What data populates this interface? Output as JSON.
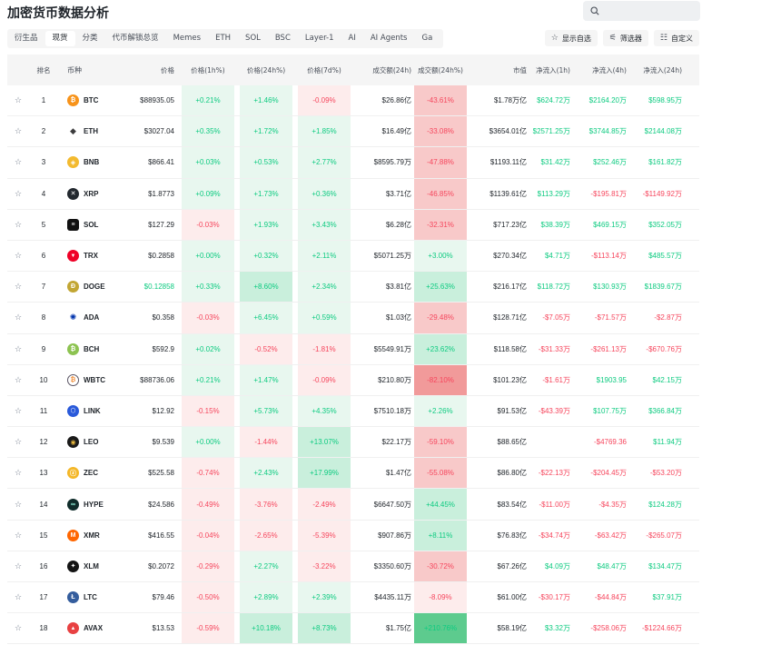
{
  "page": {
    "title": "加密货币数据分析"
  },
  "search": {
    "placeholder": ""
  },
  "tabs": [
    {
      "label": "衍生品",
      "active": false
    },
    {
      "label": "现货",
      "active": true
    },
    {
      "label": "分类",
      "active": false
    },
    {
      "label": "代币解锁总览",
      "active": false
    },
    {
      "label": "Memes",
      "active": false
    },
    {
      "label": "ETH",
      "active": false
    },
    {
      "label": "SOL",
      "active": false
    },
    {
      "label": "BSC",
      "active": false
    },
    {
      "label": "Layer-1",
      "active": false
    },
    {
      "label": "AI",
      "active": false
    },
    {
      "label": "AI Agents",
      "active": false
    },
    {
      "label": "Ga",
      "active": false
    }
  ],
  "actions": {
    "show_favorites": "显示自选",
    "filter": "筛选器",
    "customize": "自定义"
  },
  "columns": {
    "rank": "排名",
    "coin": "币种",
    "price": "价格",
    "p1h": "价格(1h%)",
    "p24h": "价格(24h%)",
    "p7d": "价格(7d%)",
    "vol": "成交额(24h)",
    "volc": "成交额(24h%)",
    "mcap": "市值",
    "n1h": "净流入(1h)",
    "n4h": "净流入(4h)",
    "n24h": "净流入(24h)"
  },
  "colors": {
    "positive": "#0ecb81",
    "negative": "#f6465d"
  },
  "rows": [
    {
      "rank": "1",
      "symbol": "BTC",
      "icon": "bitcoin-icon",
      "price": "$88935.05",
      "p1h": "+0.21%",
      "p24h": "+1.46%",
      "p7d": "-0.09%",
      "vol": "$26.86亿",
      "volc": "-43.61%",
      "mcap": "$1.78万亿",
      "n1h": "$624.72万",
      "n4h": "$2164.20万",
      "n24h": "$598.95万"
    },
    {
      "rank": "2",
      "symbol": "ETH",
      "icon": "ethereum-icon",
      "price": "$3027.04",
      "p1h": "+0.35%",
      "p24h": "+1.72%",
      "p7d": "+1.85%",
      "vol": "$16.49亿",
      "volc": "-33.08%",
      "mcap": "$3654.01亿",
      "n1h": "$2571.25万",
      "n4h": "$3744.85万",
      "n24h": "$2144.08万"
    },
    {
      "rank": "3",
      "symbol": "BNB",
      "icon": "bnb-icon",
      "price": "$866.41",
      "p1h": "+0.03%",
      "p24h": "+0.53%",
      "p7d": "+2.77%",
      "vol": "$8595.79万",
      "volc": "-47.88%",
      "mcap": "$1193.11亿",
      "n1h": "$31.42万",
      "n4h": "$252.46万",
      "n24h": "$161.82万"
    },
    {
      "rank": "4",
      "symbol": "XRP",
      "icon": "xrp-icon",
      "price": "$1.8773",
      "p1h": "+0.09%",
      "p24h": "+1.73%",
      "p7d": "+0.36%",
      "vol": "$3.71亿",
      "volc": "-46.85%",
      "mcap": "$1139.61亿",
      "n1h": "$113.29万",
      "n4h": "-$195.81万",
      "n24h": "-$1149.92万"
    },
    {
      "rank": "5",
      "symbol": "SOL",
      "icon": "solana-icon",
      "price": "$127.29",
      "p1h": "-0.03%",
      "p24h": "+1.93%",
      "p7d": "+3.43%",
      "vol": "$6.28亿",
      "volc": "-32.31%",
      "mcap": "$717.23亿",
      "n1h": "$38.39万",
      "n4h": "$469.15万",
      "n24h": "$352.05万"
    },
    {
      "rank": "6",
      "symbol": "TRX",
      "icon": "tron-icon",
      "price": "$0.2858",
      "p1h": "+0.00%",
      "p24h": "+0.32%",
      "p7d": "+2.11%",
      "vol": "$5071.25万",
      "volc": "+3.00%",
      "mcap": "$270.34亿",
      "n1h": "$4.71万",
      "n4h": "-$113.14万",
      "n24h": "$485.57万"
    },
    {
      "rank": "7",
      "symbol": "DOGE",
      "icon": "dogecoin-icon",
      "price": "$0.12858",
      "p1h": "+0.33%",
      "p24h": "+8.60%",
      "p7d": "+2.34%",
      "vol": "$3.81亿",
      "volc": "+25.63%",
      "mcap": "$216.17亿",
      "n1h": "$118.72万",
      "n4h": "$130.93万",
      "n24h": "$1839.67万"
    },
    {
      "rank": "8",
      "symbol": "ADA",
      "icon": "cardano-icon",
      "price": "$0.358",
      "p1h": "-0.03%",
      "p24h": "+6.45%",
      "p7d": "+0.59%",
      "vol": "$1.03亿",
      "volc": "-29.48%",
      "mcap": "$128.71亿",
      "n1h": "-$7.05万",
      "n4h": "-$71.57万",
      "n24h": "-$2.87万"
    },
    {
      "rank": "9",
      "symbol": "BCH",
      "icon": "bitcoin-cash-icon",
      "price": "$592.9",
      "p1h": "+0.02%",
      "p24h": "-0.52%",
      "p7d": "-1.81%",
      "vol": "$5549.91万",
      "volc": "+23.62%",
      "mcap": "$118.58亿",
      "n1h": "-$31.33万",
      "n4h": "-$261.13万",
      "n24h": "-$670.76万"
    },
    {
      "rank": "10",
      "symbol": "WBTC",
      "icon": "wrapped-bitcoin-icon",
      "price": "$88736.06",
      "p1h": "+0.21%",
      "p24h": "+1.47%",
      "p7d": "-0.09%",
      "vol": "$210.80万",
      "volc": "-82.10%",
      "mcap": "$101.23亿",
      "n1h": "-$1.61万",
      "n4h": "$1903.95",
      "n24h": "$42.15万"
    },
    {
      "rank": "11",
      "symbol": "LINK",
      "icon": "chainlink-icon",
      "price": "$12.92",
      "p1h": "-0.15%",
      "p24h": "+5.73%",
      "p7d": "+4.35%",
      "vol": "$7510.18万",
      "volc": "+2.26%",
      "mcap": "$91.53亿",
      "n1h": "-$43.39万",
      "n4h": "$107.75万",
      "n24h": "$366.84万"
    },
    {
      "rank": "12",
      "symbol": "LEO",
      "icon": "leo-icon",
      "price": "$9.539",
      "p1h": "+0.00%",
      "p24h": "-1.44%",
      "p7d": "+13.07%",
      "vol": "$22.17万",
      "volc": "-59.10%",
      "mcap": "$88.65亿",
      "n1h": "",
      "n4h": "-$4769.36",
      "n24h": "$11.94万"
    },
    {
      "rank": "13",
      "symbol": "ZEC",
      "icon": "zcash-icon",
      "price": "$525.58",
      "p1h": "-0.74%",
      "p24h": "+2.43%",
      "p7d": "+17.99%",
      "vol": "$1.47亿",
      "volc": "-55.08%",
      "mcap": "$86.80亿",
      "n1h": "-$22.13万",
      "n4h": "-$204.45万",
      "n24h": "-$53.20万"
    },
    {
      "rank": "14",
      "symbol": "HYPE",
      "icon": "hyperliquid-icon",
      "price": "$24.586",
      "p1h": "-0.49%",
      "p24h": "-3.76%",
      "p7d": "-2.49%",
      "vol": "$6647.50万",
      "volc": "+44.45%",
      "mcap": "$83.54亿",
      "n1h": "-$11.00万",
      "n4h": "-$4.35万",
      "n24h": "$124.28万"
    },
    {
      "rank": "15",
      "symbol": "XMR",
      "icon": "monero-icon",
      "price": "$416.55",
      "p1h": "-0.04%",
      "p24h": "-2.65%",
      "p7d": "-5.39%",
      "vol": "$907.86万",
      "volc": "+8.11%",
      "mcap": "$76.83亿",
      "n1h": "-$34.74万",
      "n4h": "-$63.42万",
      "n24h": "-$265.07万"
    },
    {
      "rank": "16",
      "symbol": "XLM",
      "icon": "stellar-icon",
      "price": "$0.2072",
      "p1h": "-0.29%",
      "p24h": "+2.27%",
      "p7d": "-3.22%",
      "vol": "$3350.60万",
      "volc": "-30.72%",
      "mcap": "$67.26亿",
      "n1h": "$4.09万",
      "n4h": "$48.47万",
      "n24h": "$134.47万"
    },
    {
      "rank": "17",
      "symbol": "LTC",
      "icon": "litecoin-icon",
      "price": "$79.46",
      "p1h": "-0.50%",
      "p24h": "+2.89%",
      "p7d": "+2.39%",
      "vol": "$4435.11万",
      "volc": "-8.09%",
      "mcap": "$61.00亿",
      "n1h": "-$30.17万",
      "n4h": "-$44.84万",
      "n24h": "$37.91万"
    },
    {
      "rank": "18",
      "symbol": "AVAX",
      "icon": "avalanche-icon",
      "price": "$13.53",
      "p1h": "-0.59%",
      "p24h": "+10.18%",
      "p7d": "+8.73%",
      "vol": "$1.75亿",
      "volc": "+210.76%",
      "mcap": "$58.19亿",
      "n1h": "$3.32万",
      "n4h": "-$258.06万",
      "n24h": "-$1224.66万"
    }
  ]
}
